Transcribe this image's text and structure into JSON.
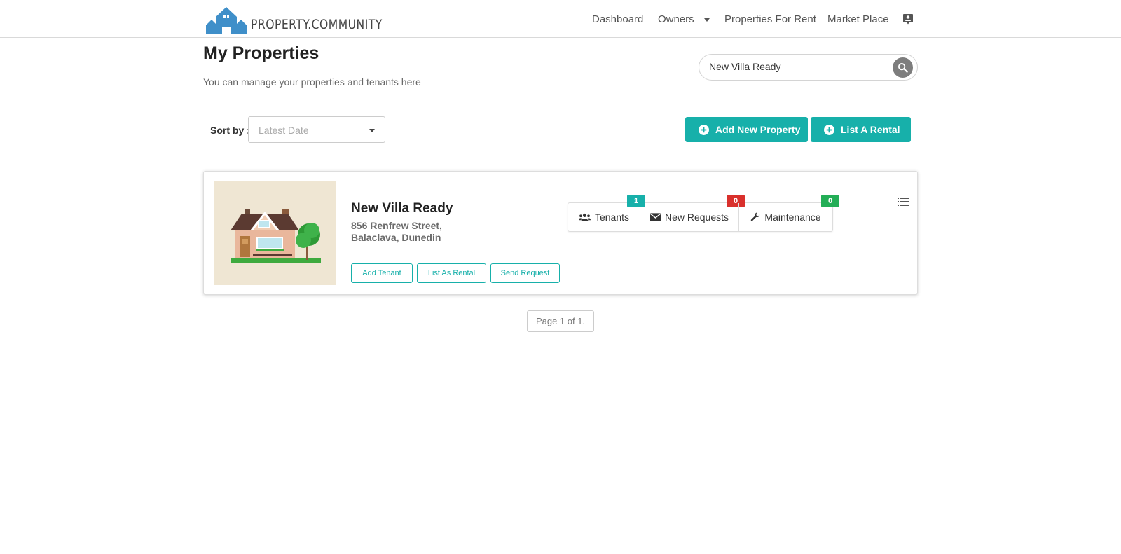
{
  "brand": {
    "name": "PROPERTY.COMMUNITY",
    "color": "#3f8fc9"
  },
  "nav": {
    "items": [
      {
        "label": "Dashboard"
      },
      {
        "label": "Owners"
      },
      {
        "label": "Properties For Rent"
      },
      {
        "label": "Market Place"
      }
    ],
    "profile_icon": "profile-icon"
  },
  "page": {
    "title": "My Properties",
    "subtitle": "You can manage your properties and tenants here"
  },
  "search": {
    "value": "New Villa Ready",
    "icon": "search-icon"
  },
  "sort": {
    "label": "Sort by :",
    "selected": "Latest Date"
  },
  "actions": {
    "add_property": "Add New Property",
    "list_rental": "List A Rental"
  },
  "colors": {
    "accent": "#17b0aa",
    "badge_tenants": "#17b0aa",
    "badge_requests": "#d9302c",
    "badge_maintenance": "#23ae56"
  },
  "property": {
    "name": "New Villa Ready",
    "address": "856 Renfrew Street, Balaclava, Dunedin",
    "buttons": {
      "add_tenant": "Add Tenant",
      "list_as_rental": "List As Rental",
      "send_request": "Send Request"
    },
    "stats": {
      "tenants": {
        "label": "Tenants",
        "count": "1"
      },
      "requests": {
        "label": "New Requests",
        "count": "0"
      },
      "maintenance": {
        "label": "Maintenance",
        "count": "0"
      }
    }
  },
  "pagination": {
    "text": "Page 1 of 1."
  }
}
